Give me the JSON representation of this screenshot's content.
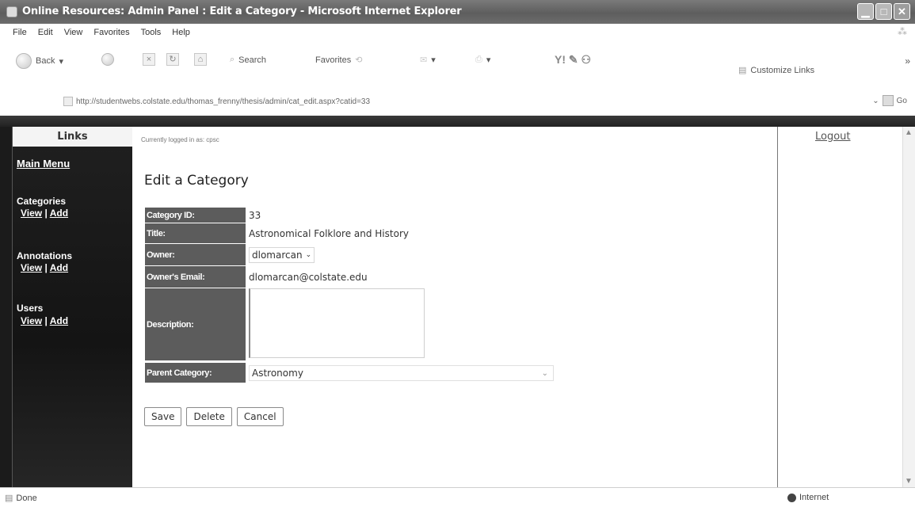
{
  "window": {
    "title": "Online Resources: Admin Panel : Edit a Category - Microsoft Internet Explorer",
    "min_glyph": "▁",
    "max_glyph": "□",
    "close_glyph": "✕"
  },
  "menu": [
    "File",
    "Edit",
    "View",
    "Favorites",
    "Tools",
    "Help"
  ],
  "toolbar": {
    "back": "Back",
    "search": "Search",
    "favorites": "Favorites",
    "customize_links": "Customize Links"
  },
  "address": {
    "url": "http://studentwebs.colstate.edu/thomas_frenny/thesis/admin/cat_edit.aspx?catid=33",
    "go": "Go"
  },
  "sidebar": {
    "header": "Links",
    "main_menu": "Main Menu",
    "sections": [
      {
        "title": "Categories",
        "view": "View",
        "sep": "|",
        "add": "Add"
      },
      {
        "title": "Annotations",
        "view": "View",
        "sep": "|",
        "add": "Add"
      },
      {
        "title": "Users",
        "view": "View",
        "sep": "|",
        "add": "Add"
      }
    ]
  },
  "page": {
    "logged_in": "Currently logged in as: cpsc",
    "logout": "Logout",
    "heading": "Edit a Category"
  },
  "form": {
    "category_id_label": "Category ID:",
    "category_id": "33",
    "title_label": "Title:",
    "title": "Astronomical Folklore and History",
    "owner_label": "Owner:",
    "owner": "dlomarcan",
    "email_label": "Owner's Email:",
    "email": "dlomarcan@colstate.edu",
    "description_label": "Description:",
    "description": "",
    "parent_label": "Parent Category:",
    "parent": "Astronomy"
  },
  "buttons": {
    "save": "Save",
    "delete": "Delete",
    "cancel": "Cancel"
  },
  "status": {
    "left": "Done",
    "right": "Internet"
  }
}
